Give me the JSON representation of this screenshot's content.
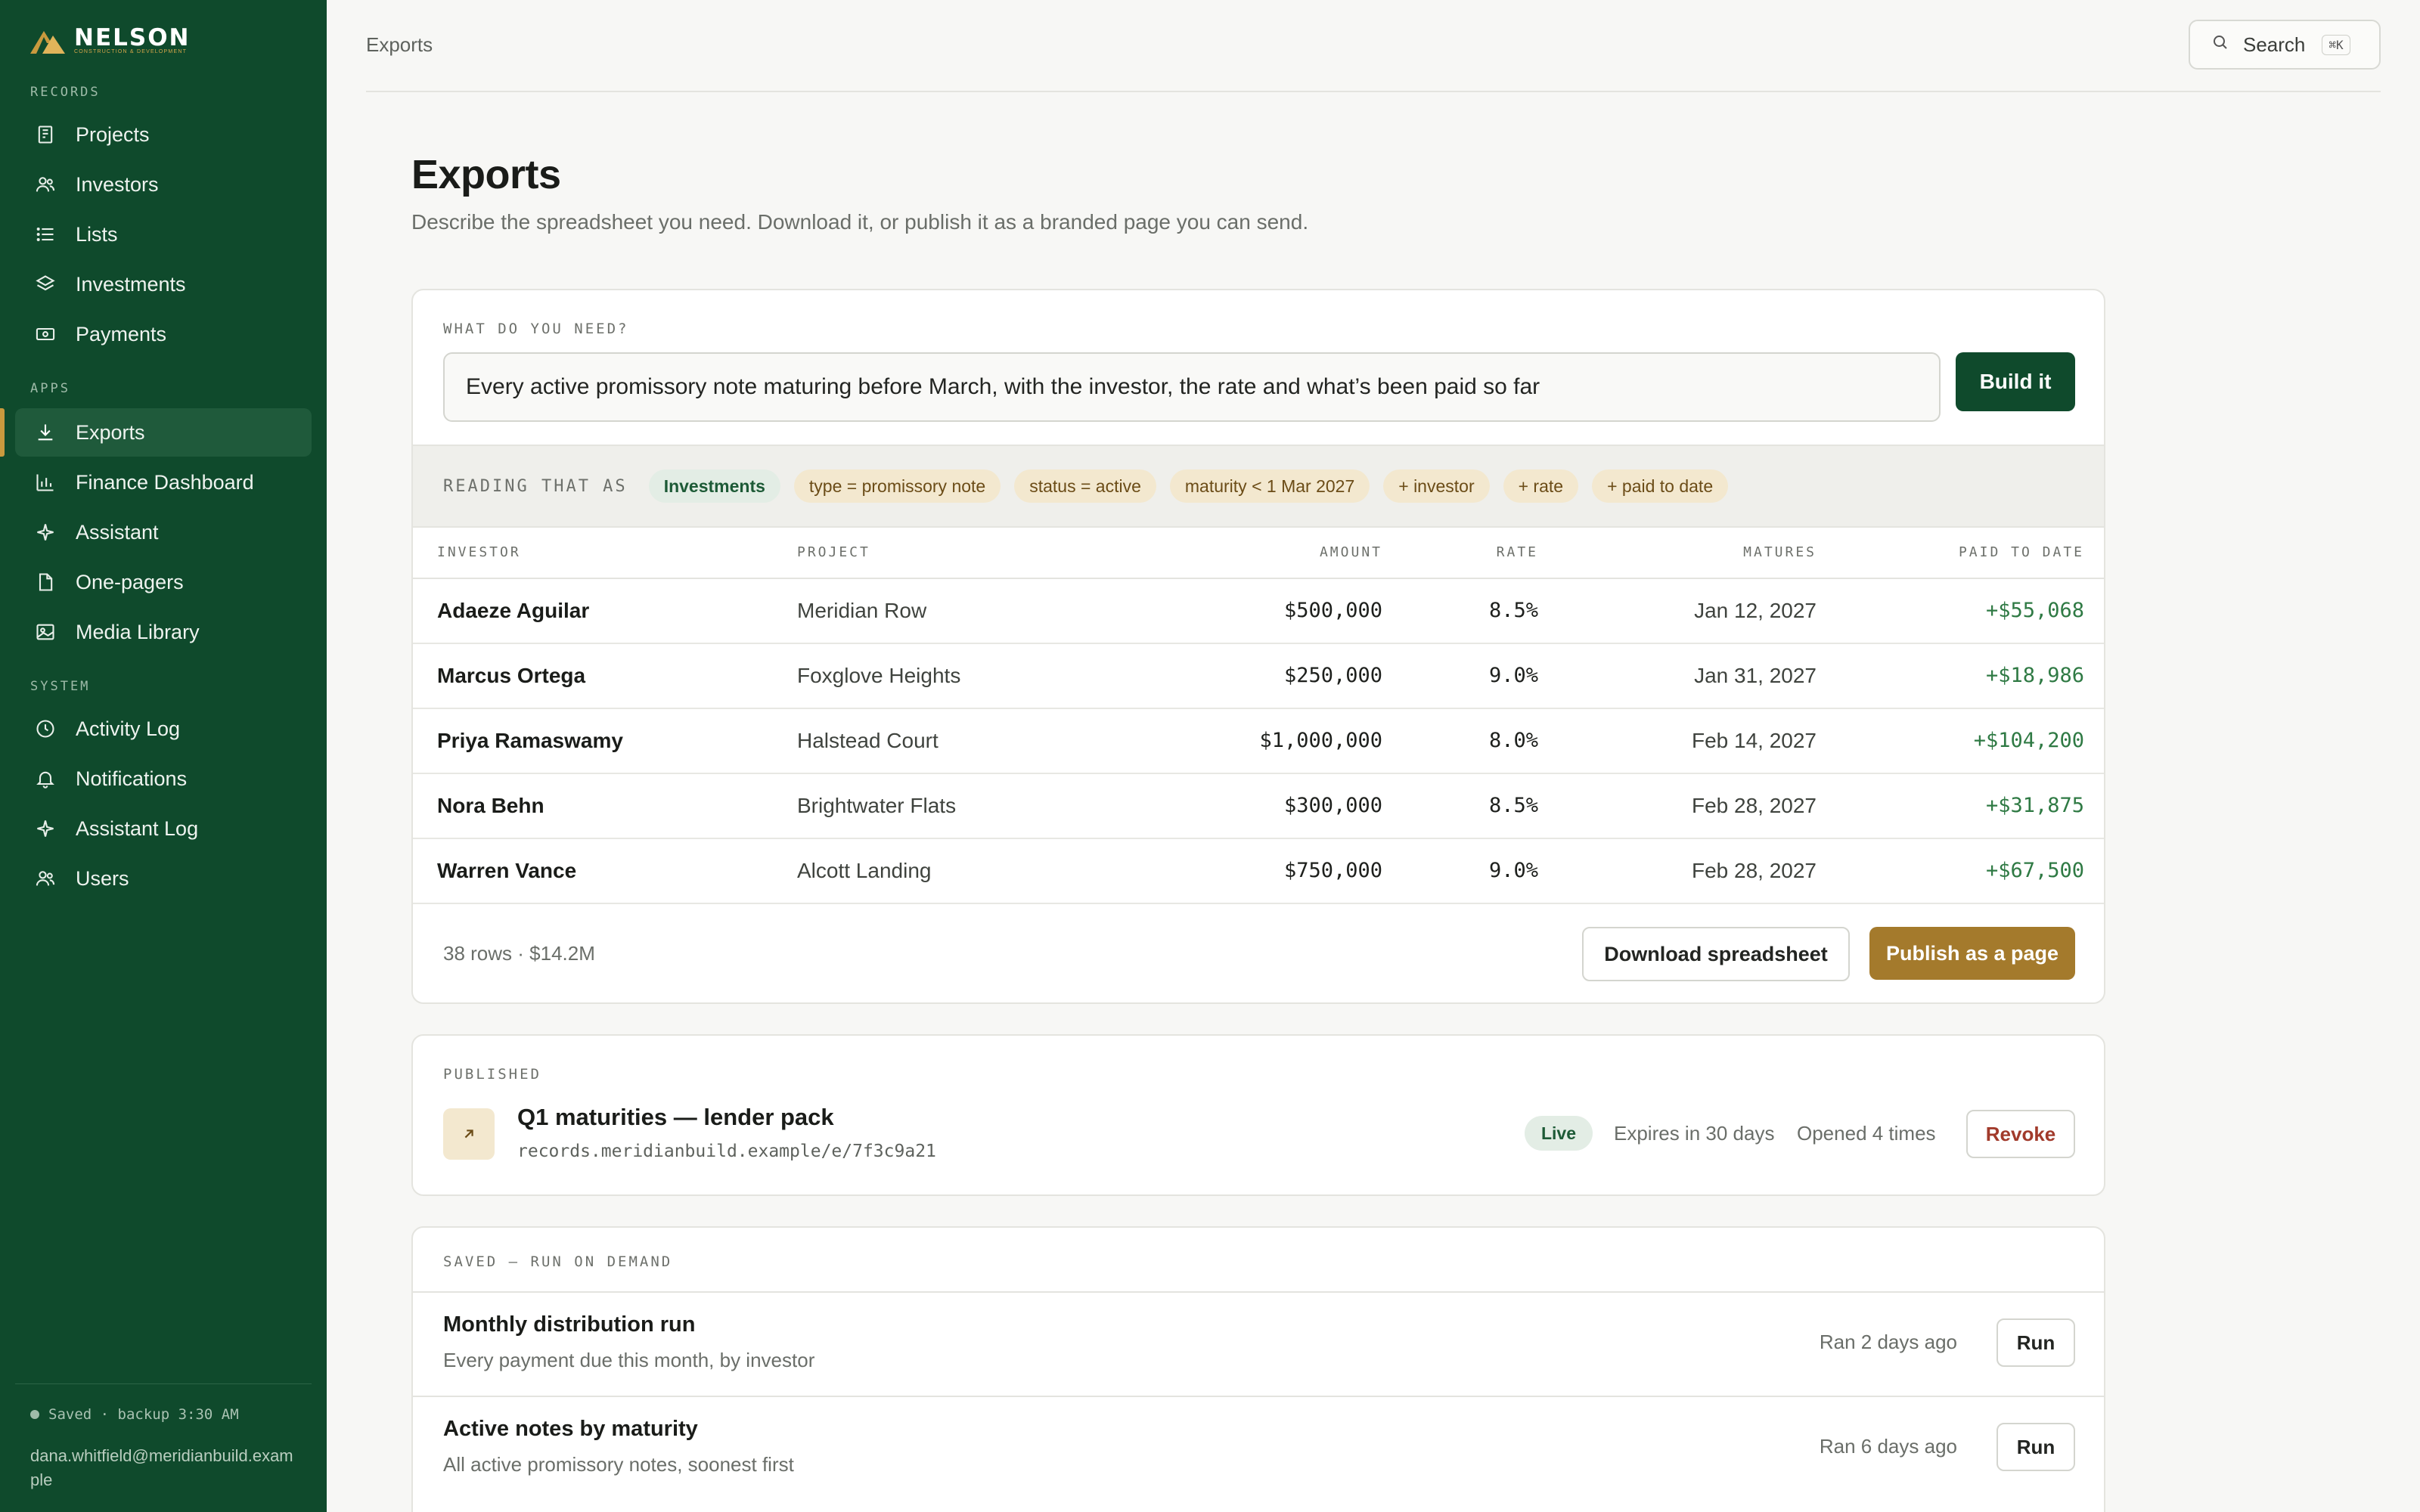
{
  "brand": {
    "name": "NELSON",
    "tagline": "CONSTRUCTION & DEVELOPMENT",
    "accent": "#c99a3e",
    "sidebar_bg": "#0f4a2c"
  },
  "sidebar": {
    "sections": {
      "records": "RECORDS",
      "apps": "APPS",
      "system": "SYSTEM"
    },
    "records": [
      {
        "label": "Projects",
        "icon": "building-icon"
      },
      {
        "label": "Investors",
        "icon": "people-icon"
      },
      {
        "label": "Lists",
        "icon": "list-icon"
      },
      {
        "label": "Investments",
        "icon": "layers-icon"
      },
      {
        "label": "Payments",
        "icon": "cash-icon"
      }
    ],
    "apps": [
      {
        "label": "Exports",
        "icon": "download-icon",
        "active": true
      },
      {
        "label": "Finance Dashboard",
        "icon": "bar-chart-icon"
      },
      {
        "label": "Assistant",
        "icon": "sparkle-icon"
      },
      {
        "label": "One-pagers",
        "icon": "file-icon"
      },
      {
        "label": "Media Library",
        "icon": "image-icon"
      }
    ],
    "system": [
      {
        "label": "Activity Log",
        "icon": "clock-icon"
      },
      {
        "label": "Notifications",
        "icon": "bell-icon"
      },
      {
        "label": "Assistant Log",
        "icon": "sparkle-icon"
      },
      {
        "label": "Users",
        "icon": "people-icon"
      }
    ],
    "footer": {
      "status": "Saved · backup 3:30 AM",
      "email": "dana.whitfield@meridianbuild.example"
    }
  },
  "topbar": {
    "breadcrumb": "Exports",
    "search_label": "Search",
    "search_shortcut": "⌘K"
  },
  "page": {
    "title": "Exports",
    "subtitle": "Describe the spreadsheet you need. Download it, or publish it as a branded page you can send."
  },
  "query": {
    "label": "WHAT DO YOU NEED?",
    "value": "Every active promissory note maturing before March, with the investor, the rate and what’s been paid so far",
    "build_label": "Build it",
    "reading_label": "READING THAT AS",
    "chips": [
      {
        "text": "Investments",
        "kind": "green"
      },
      {
        "text": "type = promissory note",
        "kind": "tan"
      },
      {
        "text": "status = active",
        "kind": "tan"
      },
      {
        "text": "maturity < 1 Mar 2027",
        "kind": "tan"
      },
      {
        "text": "+ investor",
        "kind": "tan"
      },
      {
        "text": "+ rate",
        "kind": "tan"
      },
      {
        "text": "+ paid to date",
        "kind": "tan"
      }
    ],
    "columns": [
      "INVESTOR",
      "PROJECT",
      "AMOUNT",
      "RATE",
      "MATURES",
      "PAID TO DATE"
    ],
    "rows": [
      {
        "investor": "Adaeze Aguilar",
        "project": "Meridian Row",
        "amount": "$500,000",
        "rate": "8.5%",
        "matures": "Jan 12, 2027",
        "paid": "+$55,068"
      },
      {
        "investor": "Marcus Ortega",
        "project": "Foxglove Heights",
        "amount": "$250,000",
        "rate": "9.0%",
        "matures": "Jan 31, 2027",
        "paid": "+$18,986"
      },
      {
        "investor": "Priya Ramaswamy",
        "project": "Halstead Court",
        "amount": "$1,000,000",
        "rate": "8.0%",
        "matures": "Feb 14, 2027",
        "paid": "+$104,200"
      },
      {
        "investor": "Nora Behn",
        "project": "Brightwater Flats",
        "amount": "$300,000",
        "rate": "8.5%",
        "matures": "Feb 28, 2027",
        "paid": "+$31,875"
      },
      {
        "investor": "Warren Vance",
        "project": "Alcott Landing",
        "amount": "$750,000",
        "rate": "9.0%",
        "matures": "Feb 28, 2027",
        "paid": "+$67,500"
      }
    ],
    "summary": "38 rows · $14.2M",
    "download_label": "Download spreadsheet",
    "publish_label": "Publish as a page"
  },
  "published": {
    "label": "PUBLISHED",
    "title": "Q1 maturities — lender pack",
    "url": "records.meridianbuild.example/e/7f3c9a21",
    "status": "Live",
    "expires": "Expires in 30 days",
    "opened": "Opened 4 times",
    "revoke_label": "Revoke"
  },
  "saved": {
    "label": "SAVED — RUN ON DEMAND",
    "items": [
      {
        "title": "Monthly distribution run",
        "desc": "Every payment due this month, by investor",
        "ran": "Ran 2 days ago",
        "run_label": "Run"
      },
      {
        "title": "Active notes by maturity",
        "desc": "All active promissory notes, soonest first",
        "ran": "Ran 6 days ago",
        "run_label": "Run"
      }
    ]
  }
}
